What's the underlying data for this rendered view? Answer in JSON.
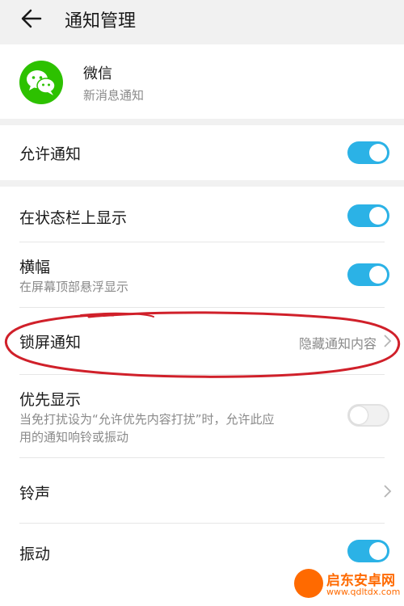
{
  "header": {
    "title": "通知管理",
    "back_icon": "arrow-left-icon"
  },
  "app": {
    "name": "微信",
    "subtitle": "新消息通知",
    "logo_icon": "wechat-icon",
    "logo_color": "#2dc100"
  },
  "allow": {
    "label": "允许通知",
    "enabled": true
  },
  "rows": {
    "status_bar": {
      "label": "在状态栏上显示",
      "enabled": true
    },
    "banner": {
      "label": "横幅",
      "sub": "在屏幕顶部悬浮显示",
      "enabled": true
    },
    "lock_screen": {
      "label": "锁屏通知",
      "value": "隐藏通知内容"
    },
    "priority": {
      "label": "优先显示",
      "sub_line1": "当免打扰设为“允许优先内容打扰”时，允许此应",
      "sub_line2": "用的通知响铃或振动",
      "enabled": false
    },
    "ringtone": {
      "label": "铃声"
    },
    "vibrate": {
      "label": "振动",
      "enabled": true
    }
  },
  "colors": {
    "accent": "#2bb2e6",
    "annotation": "#d0202a"
  },
  "watermark": {
    "name": "启东安卓网",
    "url": "www.qdltdx.com"
  }
}
